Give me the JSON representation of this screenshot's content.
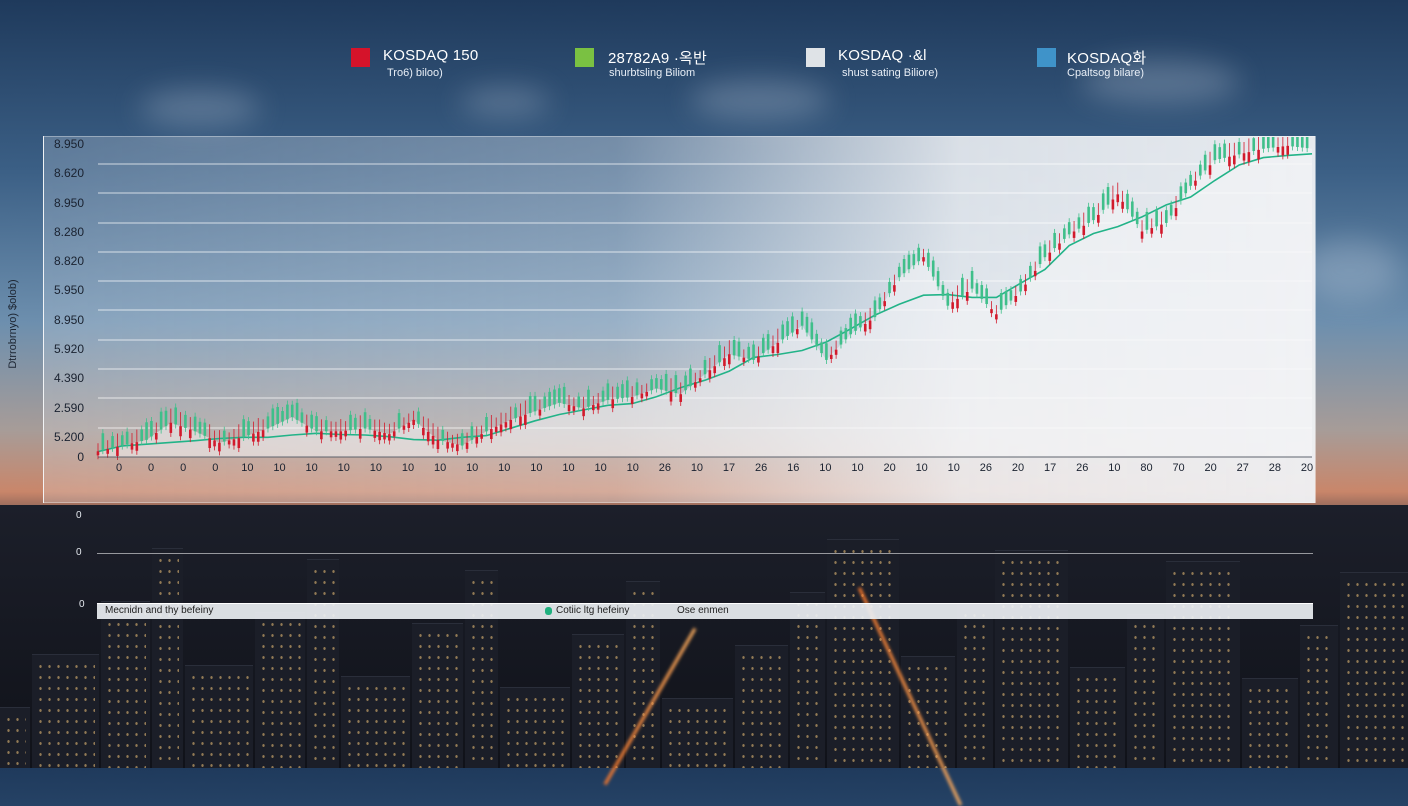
{
  "legend": [
    {
      "name": "KOSDAQ 150",
      "sub": "Tro6) biloo)",
      "color": "#d5132a"
    },
    {
      "name": "28782A9 ·옥반",
      "sub": "shurbtsling Biliom",
      "color": "#7ac142"
    },
    {
      "name": "KOSDAQ ·&l",
      "sub": "shust sating Biliore)",
      "color": "#dfe3e7"
    },
    {
      "name": "KOSDAQ화",
      "sub": "Cpaltsog bilare)",
      "color": "#3f93c9"
    }
  ],
  "colors": {
    "up": "#3fbf8a",
    "down": "#d21a2c",
    "ma": "#22b388"
  },
  "chart_data": {
    "type": "line",
    "ylabel": "Dtrrobrnyo) $olob)",
    "y_tick_labels": [
      "8.950",
      "8.620",
      "8.950",
      "8.280",
      "8.820",
      "5.950",
      "8.950",
      "5.920",
      "4.390",
      "2.590",
      "5.200",
      "0"
    ],
    "x_tick_labels": [
      "0",
      "0",
      "0",
      "0",
      "10",
      "10",
      "10",
      "10",
      "10",
      "10",
      "10",
      "10",
      "10",
      "10",
      "10",
      "10",
      "10",
      "26",
      "10",
      "17",
      "26",
      "16",
      "10",
      "10",
      "20",
      "10",
      "10",
      "26",
      "20",
      "17",
      "26",
      "10",
      "80",
      "70",
      "20",
      "27",
      "28",
      "20"
    ],
    "ylim": [
      0,
      11
    ],
    "grid": true,
    "series": [
      {
        "x": [
          0,
          2,
          4,
          6,
          8,
          10,
          12,
          14,
          16,
          18,
          20,
          22,
          24,
          26,
          28,
          30,
          32,
          34,
          36,
          38,
          40,
          42,
          44,
          46,
          48,
          50,
          52,
          54,
          56,
          58,
          60,
          62,
          64,
          66,
          68,
          70,
          72,
          74,
          76,
          78,
          80,
          82,
          84,
          86,
          88,
          90,
          92,
          94,
          96,
          98,
          100
        ],
        "y": [
          0.2,
          0.4,
          0.6,
          1.2,
          0.9,
          0.5,
          0.7,
          1.0,
          1.4,
          0.9,
          0.9,
          1.0,
          0.8,
          1.3,
          0.6,
          0.4,
          0.9,
          1.3,
          1.6,
          1.9,
          1.7,
          2.0,
          2.1,
          2.4,
          2.2,
          2.9,
          3.6,
          3.4,
          4.0,
          4.6,
          3.4,
          4.3,
          4.9,
          6.3,
          7.0,
          5.3,
          5.9,
          5.0,
          5.8,
          7.0,
          7.8,
          8.3,
          9.2,
          7.9,
          8.2,
          9.5,
          10.4,
          10.6,
          10.8,
          10.9,
          10.8
        ]
      }
    ]
  },
  "lower_axis": {
    "ticks": [
      "0",
      "0",
      "0"
    ]
  },
  "strip": {
    "left": "Mecnidn and thy befeiny",
    "middle": "Cotiic ltg hefeiny",
    "right": "Ose enmen"
  }
}
